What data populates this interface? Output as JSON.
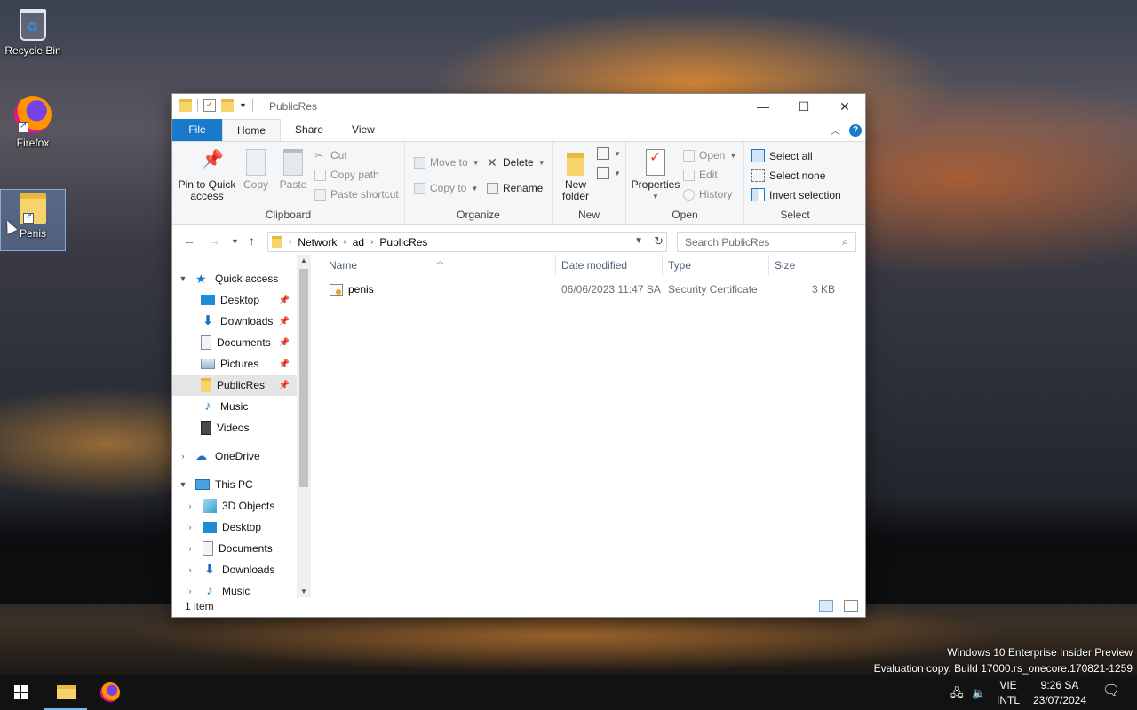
{
  "desktop": {
    "icons": [
      {
        "label": "Recycle Bin"
      },
      {
        "label": "Firefox"
      },
      {
        "label": "Penis"
      }
    ],
    "watermark_line1": "Windows 10 Enterprise Insider Preview",
    "watermark_line2": "Evaluation copy. Build 17000.rs_onecore.170821-1259"
  },
  "window": {
    "title": "PublicRes",
    "controls": {
      "minimize": "—",
      "maximize": "☐",
      "close": "✕"
    },
    "tabs": [
      "File",
      "Home",
      "Share",
      "View"
    ],
    "active_tab": "Home",
    "ribbon": {
      "clipboard": {
        "label": "Clipboard",
        "pin_line1": "Pin to Quick",
        "pin_line2": "access",
        "copy": "Copy",
        "paste": "Paste",
        "cut": "Cut",
        "copy_path": "Copy path",
        "paste_shortcut": "Paste shortcut"
      },
      "organize": {
        "label": "Organize",
        "move_to": "Move to",
        "copy_to": "Copy to",
        "delete": "Delete",
        "rename": "Rename"
      },
      "new": {
        "label": "New",
        "new_folder_line1": "New",
        "new_folder_line2": "folder"
      },
      "open": {
        "label": "Open",
        "properties": "Properties",
        "open": "Open",
        "edit": "Edit",
        "history": "History"
      },
      "select": {
        "label": "Select",
        "select_all": "Select all",
        "select_none": "Select none",
        "invert": "Invert selection"
      }
    },
    "address": {
      "crumbs": [
        "Network",
        "ad",
        "PublicRes"
      ],
      "search_placeholder": "Search PublicRes"
    },
    "nav_pane": {
      "quick_access": "Quick access",
      "quick_items": [
        {
          "label": "Desktop",
          "pinned": true
        },
        {
          "label": "Downloads",
          "pinned": true
        },
        {
          "label": "Documents",
          "pinned": true
        },
        {
          "label": "Pictures",
          "pinned": true
        },
        {
          "label": "PublicRes",
          "pinned": true
        },
        {
          "label": "Music",
          "pinned": false
        },
        {
          "label": "Videos",
          "pinned": false
        }
      ],
      "onedrive": "OneDrive",
      "this_pc": "This PC",
      "pc_items": [
        "3D Objects",
        "Desktop",
        "Documents",
        "Downloads",
        "Music"
      ]
    },
    "columns": [
      "Name",
      "Date modified",
      "Type",
      "Size"
    ],
    "files": [
      {
        "name": "penis",
        "date_modified": "06/06/2023 11:47 SA",
        "type": "Security Certificate",
        "size": "3 KB"
      }
    ],
    "status": "1 item"
  },
  "taskbar": {
    "lang_line1": "VIE",
    "lang_line2": "INTL",
    "time": "9:26 SA",
    "date": "23/07/2024"
  },
  "colors": {
    "accent": "#1979ca",
    "taskbar": "#121214",
    "selection": "#e5e5e5"
  }
}
